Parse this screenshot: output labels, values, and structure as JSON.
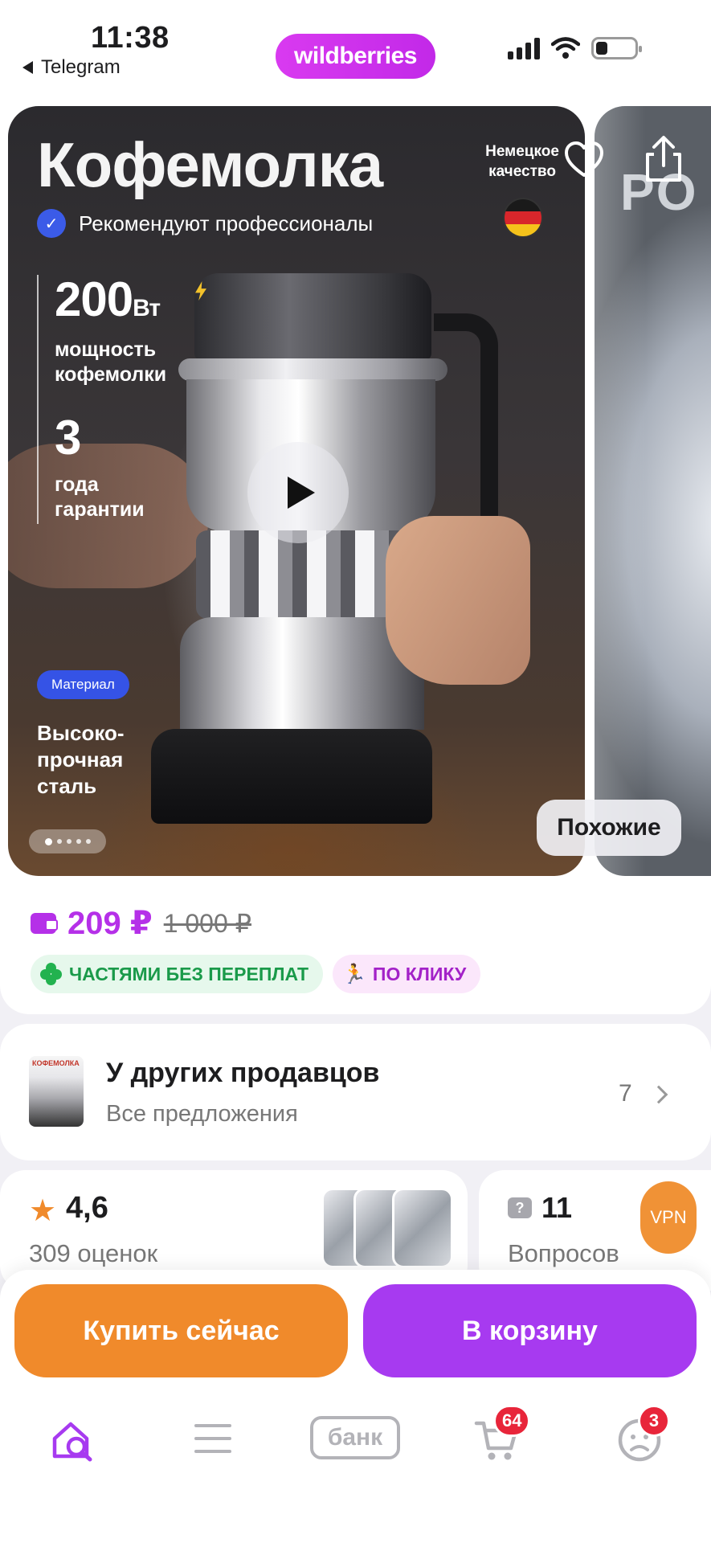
{
  "status_bar": {
    "time": "11:38",
    "back_app": "Telegram",
    "brand": "wildberries"
  },
  "gallery": {
    "headline": "Кофемолка",
    "recommend": "Рекомендуют профессионалы",
    "power_value": "200",
    "power_unit": "Вт",
    "power_label_1": "мощность",
    "power_label_2": "кофемолки",
    "warranty_value": "3",
    "warranty_label_1": "года",
    "warranty_label_2": "гарантии",
    "quality_1": "Немецкое",
    "quality_2": "качество",
    "material_badge": "Материал",
    "material_1": "Высоко-",
    "material_2": "прочная",
    "material_3": "сталь",
    "next_slide_text": "PO",
    "similar_button": "Похожие",
    "slide_count": 5,
    "active_slide": 1
  },
  "price": {
    "current": "209 ₽",
    "old": "1 000 ₽",
    "color": "#b530e8"
  },
  "chips": [
    {
      "label": "ЧАСТЯМИ БЕЗ ПЕРЕПЛАТ"
    },
    {
      "label": "ПО КЛИКУ"
    }
  ],
  "other_sellers": {
    "thumb_text": "КОФЕМОЛКА",
    "title": "У других продавцов",
    "subtitle": "Все предложения",
    "count": "7"
  },
  "rating": {
    "value": "4,6",
    "count_label": "309 оценок"
  },
  "questions": {
    "value": "11",
    "label": "Вопросов"
  },
  "vpn_label": "VPN",
  "actions": {
    "buy_now": "Купить сейчас",
    "add_to_cart": "В корзину",
    "buy_color": "#f08a2b",
    "cart_color": "#a73af0"
  },
  "tabbar": {
    "bank_label": "банк",
    "cart_badge": "64",
    "profile_badge": "3",
    "active_color": "#a73af0"
  },
  "icons": [
    "search-home-icon",
    "menu-icon",
    "bank-icon",
    "cart-icon",
    "profile-icon",
    "heart-icon",
    "share-icon",
    "play-icon",
    "star-icon",
    "question-icon",
    "wallet-icon",
    "clover-icon",
    "runner-icon",
    "verified-badge-icon"
  ]
}
